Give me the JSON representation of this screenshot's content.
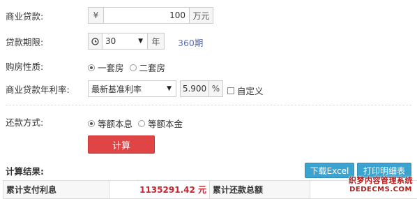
{
  "loan_amount": {
    "label": "商业贷款:",
    "prefix": "¥",
    "value": "100",
    "unit": "万元"
  },
  "loan_term": {
    "label": "贷款期限:",
    "value": "30",
    "unit": "年",
    "periods": "360期"
  },
  "house_type": {
    "label": "购房性质:",
    "options": [
      "一套房",
      "二套房"
    ]
  },
  "rate": {
    "label": "商业贷款年利率:",
    "select_value": "最新基准利率",
    "value": "5.900",
    "unit": "%",
    "custom_label": "自定义"
  },
  "repay_method": {
    "label": "还款方式:",
    "options": [
      "等额本息",
      "等额本金"
    ]
  },
  "calc_button": "计算",
  "result": {
    "title": "计算结果:",
    "download_excel": "下载Excel",
    "print_detail": "打印明细表",
    "rows": [
      {
        "k1": "累计支付利息",
        "v1": "1135291.42 元",
        "k2": "累计还款总额",
        "v2": ""
      }
    ]
  },
  "watermark": {
    "line1": "织梦内容管理系统",
    "line2": "DEDECMS.COM"
  },
  "colors": {
    "calc_button": "#e04545",
    "blue_button": "#3aa3cf",
    "period_text": "#5a6fb0",
    "result_value": "#d0202e"
  }
}
